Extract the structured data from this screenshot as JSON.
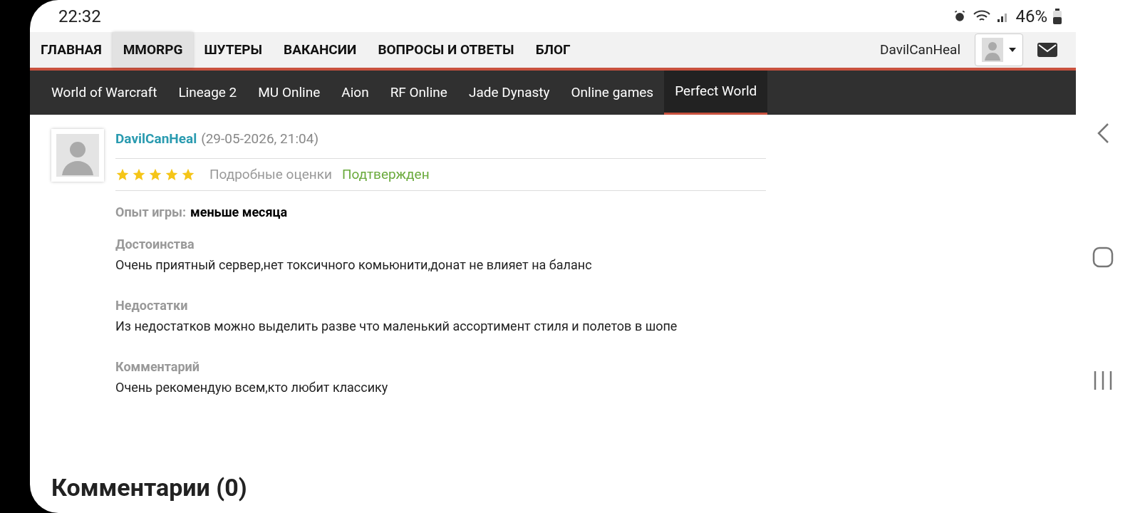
{
  "status_bar": {
    "time": "22:32",
    "battery": "46%"
  },
  "top_nav": {
    "items": [
      {
        "label": "ГЛАВНАЯ",
        "selected": false
      },
      {
        "label": "MMORPG",
        "selected": true
      },
      {
        "label": "ШУТЕРЫ",
        "selected": false
      },
      {
        "label": "ВАКАНСИИ",
        "selected": false
      },
      {
        "label": "ВОПРОСЫ И ОТВЕТЫ",
        "selected": false
      },
      {
        "label": "БЛОГ",
        "selected": false
      }
    ],
    "username": "DavilCanHeal"
  },
  "sub_nav": {
    "items": [
      {
        "label": "World of Warcraft",
        "selected": false
      },
      {
        "label": "Lineage 2",
        "selected": false
      },
      {
        "label": "MU Online",
        "selected": false
      },
      {
        "label": "Aion",
        "selected": false
      },
      {
        "label": "RF Online",
        "selected": false
      },
      {
        "label": "Jade Dynasty",
        "selected": false
      },
      {
        "label": "Online games",
        "selected": false
      },
      {
        "label": "Perfect World",
        "selected": true
      }
    ]
  },
  "review": {
    "author": "DavilCanHeal",
    "date": "(29-05-2026, 21:04)",
    "stars": 5,
    "details_link": "Подробные оценки",
    "status": "Подтвержден",
    "experience": {
      "label": "Опыт игры:",
      "value": "меньше месяца"
    },
    "sections": [
      {
        "title": "Достоинства",
        "text": "Очень приятный сервер,нет токсичного комьюнити,донат не влияет на баланс"
      },
      {
        "title": "Недостатки",
        "text": "Из недостатков можно выделить разве что маленький ассортимент стиля и полетов в шопе"
      },
      {
        "title": "Комментарий",
        "text": "Очень рекомендую всем,кто любит классику"
      }
    ]
  },
  "comments_heading": "Комментарии (0)"
}
